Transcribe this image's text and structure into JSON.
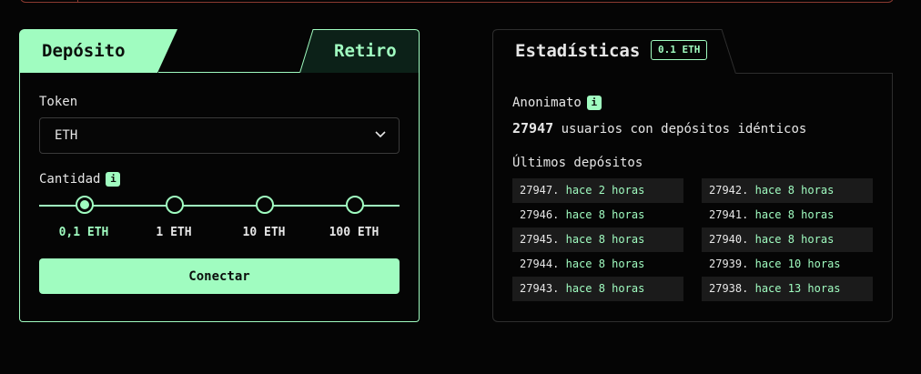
{
  "deposit_panel": {
    "tabs": {
      "active": "Depósito",
      "inactive": "Retiro"
    },
    "token_label": "Token",
    "token_value": "ETH",
    "amount_label": "Cantidad",
    "info_glyph": "i",
    "amounts": [
      "0,1 ETH",
      "1 ETH",
      "10 ETH",
      "100 ETH"
    ],
    "selected_amount": "0,1 ETH",
    "connect_label": "Conectar"
  },
  "stats_panel": {
    "title": "Estadísticas",
    "badge": "0.1 ETH",
    "anonymity_label": "Anonimato",
    "info_glyph": "i",
    "user_count": "27947",
    "users_text": "usuarios con depósitos idénticos",
    "latest_label": "Últimos depósitos",
    "deposits_left": [
      {
        "num": "27947.",
        "time": "hace 2 horas"
      },
      {
        "num": "27946.",
        "time": "hace 8 horas"
      },
      {
        "num": "27945.",
        "time": "hace 8 horas"
      },
      {
        "num": "27944.",
        "time": "hace 8 horas"
      },
      {
        "num": "27943.",
        "time": "hace 8 horas"
      }
    ],
    "deposits_right": [
      {
        "num": "27942.",
        "time": "hace 8 horas"
      },
      {
        "num": "27941.",
        "time": "hace 8 horas"
      },
      {
        "num": "27940.",
        "time": "hace 8 horas"
      },
      {
        "num": "27939.",
        "time": "hace 10 horas"
      },
      {
        "num": "27938.",
        "time": "hace 13 horas"
      }
    ]
  },
  "colors": {
    "accent": "#a0fcc0",
    "background": "#050505",
    "border_muted": "#2e2e2e",
    "alert_border": "#8a3a30"
  },
  "icons": {
    "dropdown": "chevron-down-icon",
    "info": "info-icon"
  }
}
